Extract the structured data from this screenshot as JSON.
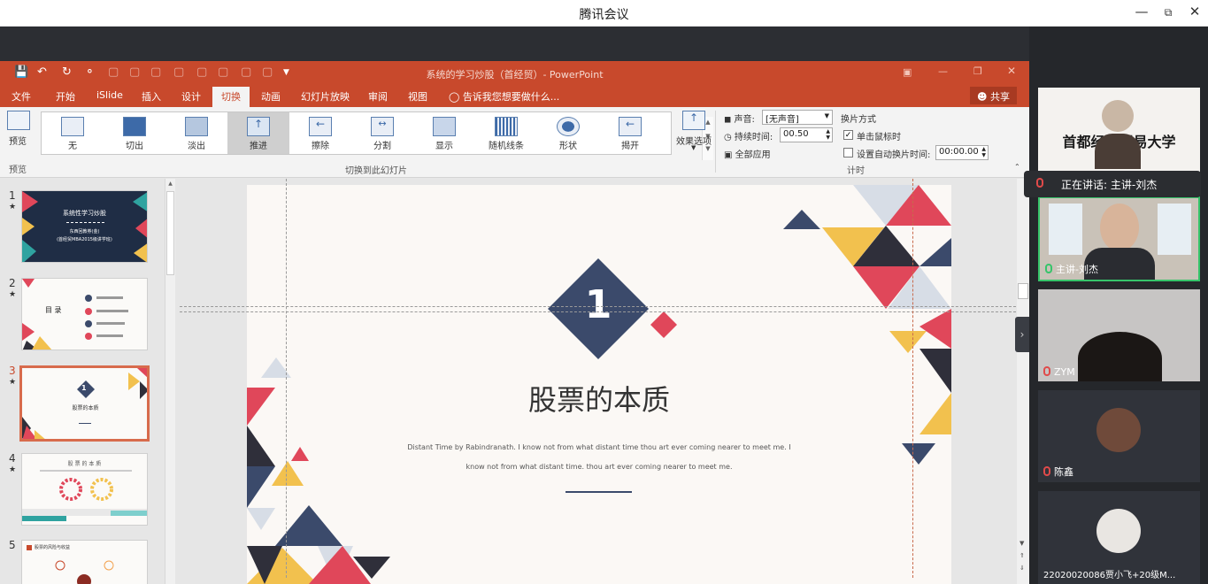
{
  "app": {
    "title": "腾讯会议"
  },
  "ppt": {
    "doc_title": "系统的学习炒股（首经贸）- PowerPoint",
    "tabs": [
      "文件",
      "开始",
      "iSlide",
      "插入",
      "设计",
      "切换",
      "动画",
      "幻灯片放映",
      "审阅",
      "视图"
    ],
    "active_tab": "切换",
    "tell_me": "告诉我您想要做什么...",
    "share": "共享",
    "ribbon": {
      "preview": "预览",
      "preview_group": "预览",
      "transitions": [
        "无",
        "切出",
        "淡出",
        "推进",
        "擦除",
        "分割",
        "显示",
        "随机线条",
        "形状",
        "揭开"
      ],
      "selected_transition": "推进",
      "transitions_group": "切换到此幻灯片",
      "effect_options": "效果选项",
      "sound_label": "声音:",
      "sound_value": "[无声音]",
      "duration_label": "持续时间:",
      "duration_value": "00.50",
      "apply_all": "全部应用",
      "advance_title": "换片方式",
      "on_click": "单击鼠标时",
      "after_label": "设置自动换片时间:",
      "after_value": "00:00.00",
      "timing_group": "计时"
    },
    "thumbnails": [
      {
        "num": "1",
        "star": "★",
        "title": "系统性学习炒股",
        "sub1": "东西回教券(金)",
        "sub2": "(首经贸MBA2015级讲学班)"
      },
      {
        "num": "2",
        "star": "★",
        "title": "目 录"
      },
      {
        "num": "3",
        "star": "★",
        "title": "股票的本质",
        "badge": "1"
      },
      {
        "num": "4",
        "star": "★",
        "title": "股 票 的 本 质"
      },
      {
        "num": "5",
        "star": "",
        "title": "股票的风险与收益"
      }
    ],
    "slide": {
      "number": "1",
      "title": "股票的本质",
      "line1": "Distant Time by Rabindranath. I know not from what distant time thou art ever coming nearer to meet me. I",
      "line2": "know not from what distant time. thou art ever coming nearer to meet me."
    },
    "colors": {
      "accent": "#c8492c",
      "navy": "#3b4a6b",
      "red": "#e0475a",
      "yellow": "#f2c14e",
      "dark": "#2f2f3a"
    }
  },
  "meeting": {
    "speaking_label": "正在讲话: 主讲-刘杰",
    "participants": [
      {
        "name": "",
        "banner": "首都经济贸易大学"
      },
      {
        "name": "主讲-刘杰",
        "mic": "green"
      },
      {
        "name": "ZYM",
        "mic": "red"
      },
      {
        "name": "陈鑫",
        "mic": "red"
      },
      {
        "name": "22020020086贾小飞+20级M..."
      }
    ]
  }
}
